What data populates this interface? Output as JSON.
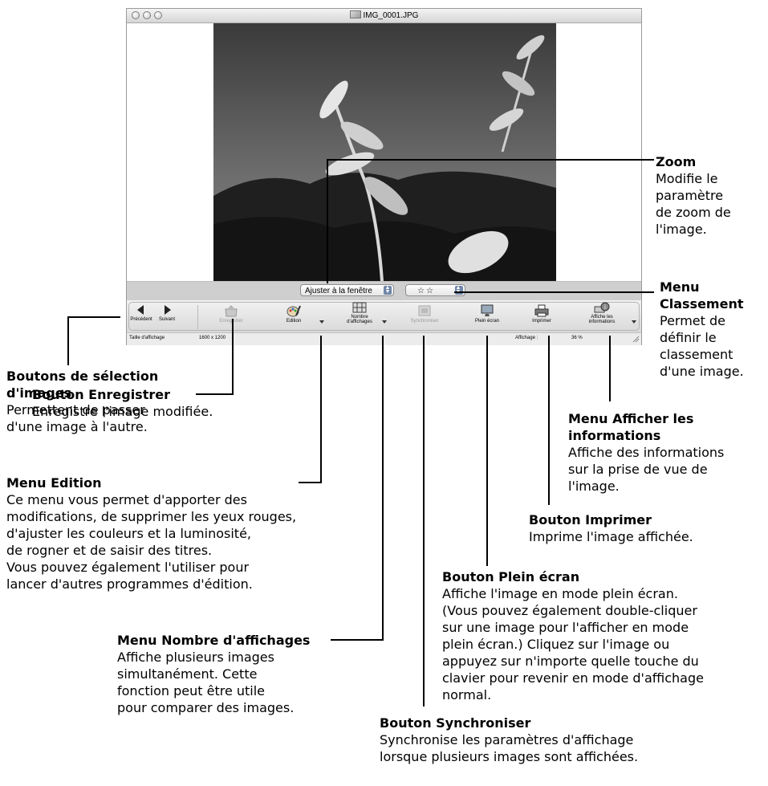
{
  "window": {
    "title": "IMG_0001.JPG",
    "zoom_select": "Ajuster à la fenêtre",
    "rating_select": "☆☆",
    "toolbar": {
      "prev": "Précédent",
      "next": "Suivant",
      "save": "Enregistrer",
      "edit": "Edition",
      "layout_1": "Nombre",
      "layout_2": "d'affichages",
      "sync": "Synchroniser",
      "fullscreen": "Plein écran",
      "print": "Imprimer",
      "info_1": "Affiche les",
      "info_2": "informations"
    },
    "status": {
      "size_label": "Taille d'affichage",
      "size_value": "1600 x 1200",
      "display_label": "Affichage :",
      "display_value": "36 %"
    }
  },
  "annotations": {
    "zoom": {
      "title": "Zoom",
      "lines": [
        "Modifie le",
        "paramètre",
        "de zoom de",
        "l'image."
      ]
    },
    "rating": {
      "title_lines": [
        "Menu",
        "Classement"
      ],
      "lines": [
        "Permet de",
        "définir le",
        "classement",
        "d'une image."
      ]
    },
    "nav": {
      "title_lines": [
        "Boutons de sélection",
        "d'images"
      ],
      "lines": [
        "Permettent de passer",
        "d'une image à l'autre."
      ]
    },
    "save": {
      "title": "Bouton Enregistrer",
      "lines": [
        "Enregistre l'image modifiée."
      ]
    },
    "info": {
      "title_lines": [
        "Menu Afficher les",
        "informations"
      ],
      "lines": [
        "Affiche des informations",
        "sur la prise de vue de",
        "l'image."
      ]
    },
    "edit": {
      "title": "Menu Edition",
      "lines": [
        "Ce menu vous permet d'apporter des",
        "modifications, de supprimer les yeux rouges,",
        "d'ajuster les couleurs et la luminosité,",
        "de rogner et de saisir des titres.",
        "Vous pouvez également l'utiliser pour",
        "lancer d'autres programmes d'édition."
      ]
    },
    "print": {
      "title": "Bouton Imprimer",
      "lines": [
        "Imprime l'image affichée."
      ]
    },
    "fullscreen": {
      "title": "Bouton Plein écran",
      "lines": [
        "Affiche l'image en mode plein écran.",
        "(Vous pouvez également double-cliquer",
        "sur une image pour l'afficher en mode",
        "plein écran.) Cliquez sur l'image ou",
        "appuyez sur n'importe quelle touche du",
        "clavier pour revenir en mode d'affichage",
        "normal."
      ]
    },
    "layout": {
      "title": "Menu Nombre d'affichages",
      "lines": [
        "Affiche plusieurs images",
        "simultanément. Cette",
        "fonction peut être utile",
        "pour comparer des images."
      ]
    },
    "sync": {
      "title": "Bouton Synchroniser",
      "lines": [
        "Synchronise les paramètres d'affichage",
        "lorsque plusieurs images sont affichées."
      ]
    }
  },
  "colors": {
    "callout_line": "#000000",
    "chrome": "#d9d9d9"
  }
}
